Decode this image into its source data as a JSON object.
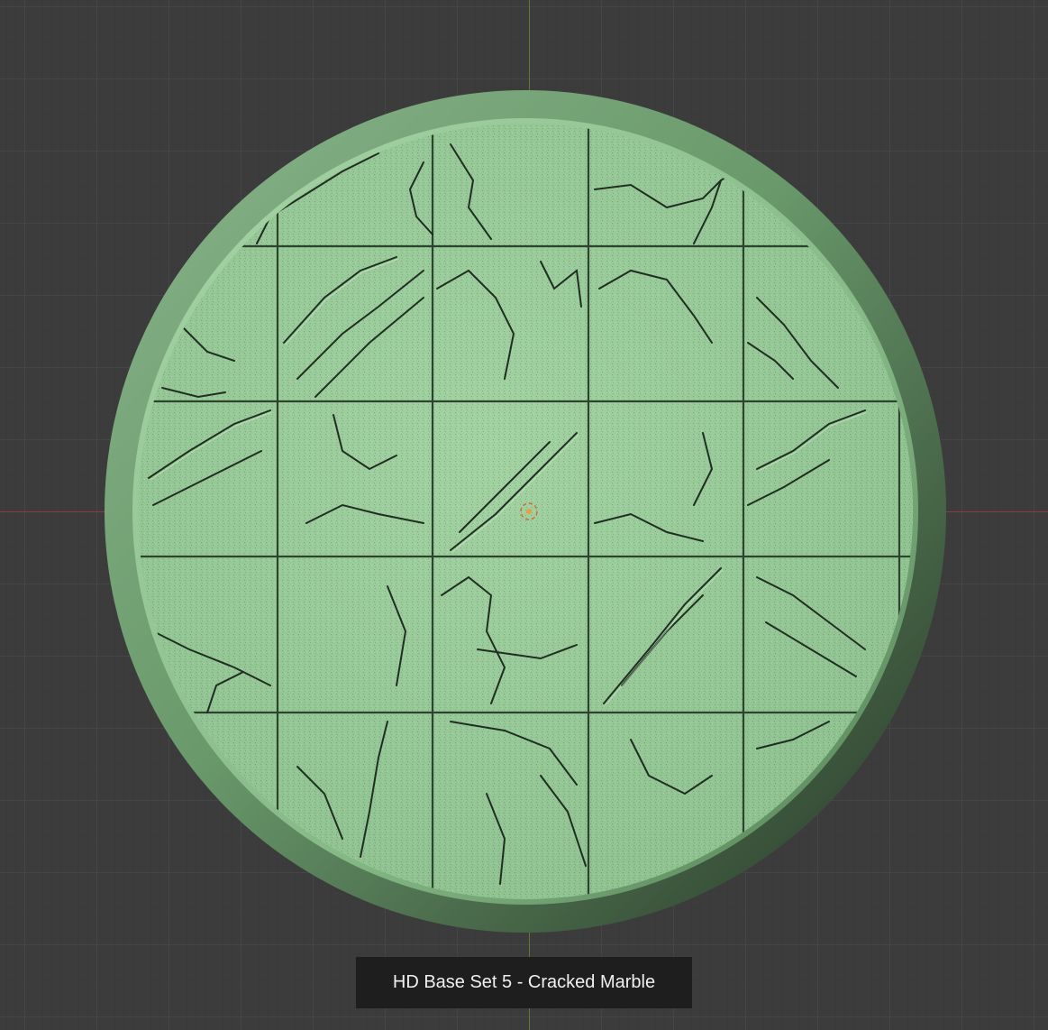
{
  "caption": {
    "text": "HD Base Set 5 - Cracked Marble"
  },
  "colors": {
    "viewport_bg": "#3c3c3c",
    "grid_line": "#464646",
    "x_axis": "#8a3c44",
    "y_axis": "#5e7a2c",
    "base_rim_light": "#7aa97d",
    "base_rim_dark": "#2c3b2c",
    "base_top": "#9ccc9d",
    "crack": "#1f2e20",
    "caption_bg": "#1e1e1e",
    "caption_text": "#f0f0f0",
    "origin_marker": "#e08a3a"
  }
}
